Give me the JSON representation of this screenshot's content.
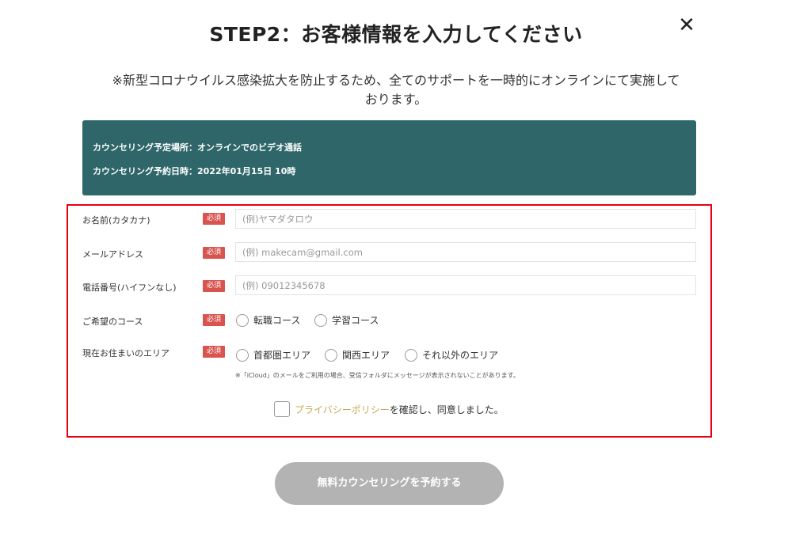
{
  "header": {
    "title": "STEP2：お客様情報を入力してください",
    "close_glyph": "✕"
  },
  "notice": {
    "line1": "※新型コロナウイルス感染拡大を防止するため、全てのサポートを一時的にオンラインにて実施して",
    "line2": "おります。"
  },
  "counseling_info": {
    "location": "カウンセリング予定場所：オンラインでのビデオ通話",
    "datetime": "カウンセリング予約日時：2022年01月15日 10時"
  },
  "form": {
    "required_badge": "必須",
    "name": {
      "label": "お名前(カタカナ)",
      "placeholder": "(例)ヤマダタロウ",
      "value": ""
    },
    "email": {
      "label": "メールアドレス",
      "placeholder": "(例) makecam@gmail.com",
      "value": ""
    },
    "phone": {
      "label": "電話番号(ハイフンなし)",
      "placeholder": "(例) 09012345678",
      "value": ""
    },
    "course": {
      "label": "ご希望のコース",
      "options": [
        "転職コース",
        "学習コース"
      ]
    },
    "area": {
      "label": "現在お住まいのエリア",
      "options": [
        "首都圏エリア",
        "関西エリア",
        "それ以外のエリア"
      ],
      "note": "※「iCloud」のメールをご利用の場合、受信フォルダにメッセージが表示されないことがあります。"
    },
    "agreement": {
      "link_text": "プライバシーポリシー",
      "text": "を確認し、同意しました。"
    }
  },
  "submit": {
    "label": "無料カウンセリングを予約する"
  },
  "colors": {
    "info_box": "#2e6669",
    "highlight_border": "#e60012",
    "badge": "#d9534f",
    "policy_link": "#c9a85c",
    "submit_disabled": "#b3b3b3"
  },
  "icons": {
    "close": "close-icon"
  }
}
